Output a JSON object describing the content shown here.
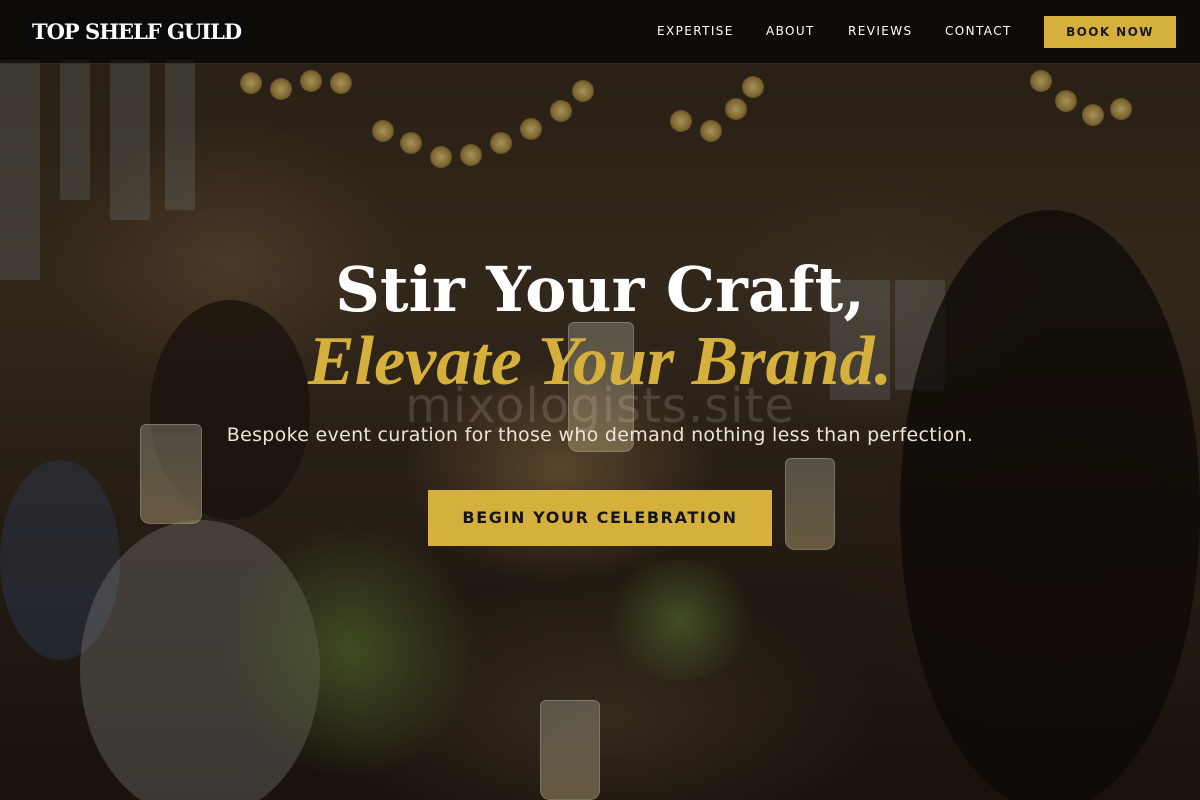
{
  "brand": {
    "logo_text": "TOP SHELF GUILD"
  },
  "nav": {
    "items": [
      {
        "label": "EXPERTISE"
      },
      {
        "label": "ABOUT"
      },
      {
        "label": "REVIEWS"
      },
      {
        "label": "CONTACT"
      }
    ],
    "book_label": "BOOK NOW"
  },
  "hero": {
    "headline_line1": "Stir Your Craft,",
    "headline_line2": "Elevate Your Brand.",
    "watermark": "mixologists.site",
    "subtitle": "Bespoke event curation for those who demand nothing less than perfection.",
    "cta_label": "BEGIN YOUR CELEBRATION"
  },
  "colors": {
    "accent_gold": "#d6b03c",
    "header_bg": "#000000",
    "text_light": "#ffffff"
  }
}
